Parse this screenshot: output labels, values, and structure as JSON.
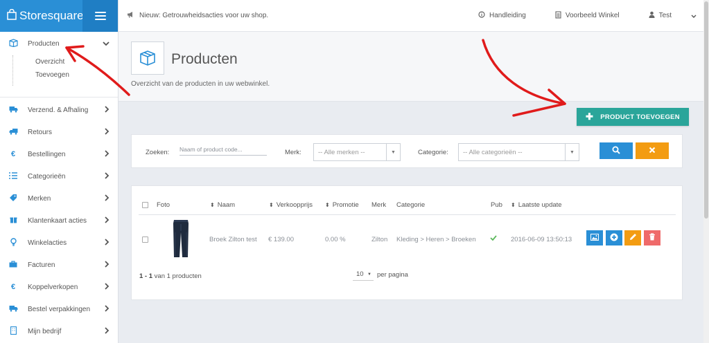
{
  "brand": {
    "name": "Storesquare"
  },
  "sidebar": {
    "active": {
      "label": "Producten",
      "sub": [
        "Overzicht",
        "Toevoegen"
      ]
    },
    "items": [
      {
        "label": "Verzend. & Afhaling",
        "icon": "truck-icon"
      },
      {
        "label": "Retours",
        "icon": "truck-return-icon"
      },
      {
        "label": "Bestellingen",
        "icon": "euro-icon"
      },
      {
        "label": "Categorieën",
        "icon": "list-icon"
      },
      {
        "label": "Merken",
        "icon": "tag-icon"
      },
      {
        "label": "Klantenkaart acties",
        "icon": "gift-icon"
      },
      {
        "label": "Winkelacties",
        "icon": "lightbulb-icon"
      },
      {
        "label": "Facturen",
        "icon": "briefcase-icon"
      },
      {
        "label": "Koppelverkopen",
        "icon": "euro-icon"
      },
      {
        "label": "Bestel verpakkingen",
        "icon": "truck-icon"
      },
      {
        "label": "Mijn bedrijf",
        "icon": "building-icon"
      }
    ]
  },
  "topbar": {
    "news": "Nieuw: Getrouwheidsacties voor uw shop.",
    "manual": "Handleiding",
    "example_store": "Voorbeeld Winkel",
    "user": "Test"
  },
  "header": {
    "title": "Producten",
    "subtitle": "Overzicht van de producten in uw webwinkel."
  },
  "add_button": {
    "label": "PRODUCT TOEVOEGEN"
  },
  "filter": {
    "search_label": "Zoeken:",
    "search_placeholder": "Naam of product code...",
    "brand_label": "Merk:",
    "brand_value": "-- Alle merken --",
    "category_label": "Categorie:",
    "category_value": "-- Alle categorieën --"
  },
  "table": {
    "headers": [
      "Foto",
      "Naam",
      "Verkoopprijs",
      "Promotie",
      "Merk",
      "Categorie",
      "Pub",
      "Laatste update"
    ],
    "rows": [
      {
        "name": "Broek Zilton test",
        "price": "€ 139.00",
        "promo": "0.00 %",
        "brand": "Zilton",
        "category": "Kleding > Heren > Broeken",
        "published": true,
        "updated": "2016-06-09 13:50:13"
      }
    ],
    "count_prefix": "1 - 1",
    "count_suffix": "van 1 producten",
    "per_page_value": "10",
    "per_page_label": "per pagina"
  },
  "colors": {
    "primary": "#2a8fd6",
    "teal": "#2aa59a",
    "orange": "#f39c12",
    "red": "#e74c3c",
    "annotation_arrow": "#e01b1b"
  }
}
